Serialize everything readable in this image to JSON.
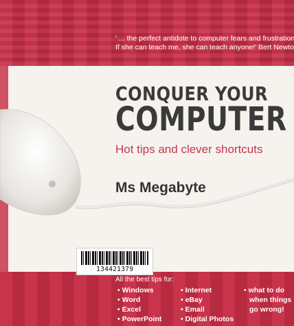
{
  "quote": {
    "line1": "' ... the perfect antidote to computer fears and frustrations.",
    "line2": "If she can teach me, she can teach anyone!'  Bert Newton"
  },
  "title": {
    "line1": "CONQUER YOUR",
    "line2": "COMPUTER"
  },
  "subtitle": "Hot tips and clever shortcuts",
  "author": "Ms Megabyte",
  "barcode": {
    "number": "134421379"
  },
  "tips": {
    "heading": "All the best tips for:",
    "col1": [
      "• Windows",
      "• Word",
      "• Excel",
      "• PowerPoint"
    ],
    "col2": [
      "• Internet",
      "• eBay",
      "• Email",
      "• Digital Photos"
    ],
    "col3": [
      "• what to do",
      "when things",
      "go wrong!"
    ]
  },
  "colors": {
    "red": "#c8344b",
    "dark_red": "#b82a40",
    "cream": "#f6f3ee",
    "title_gray": "#3a3a3a"
  }
}
